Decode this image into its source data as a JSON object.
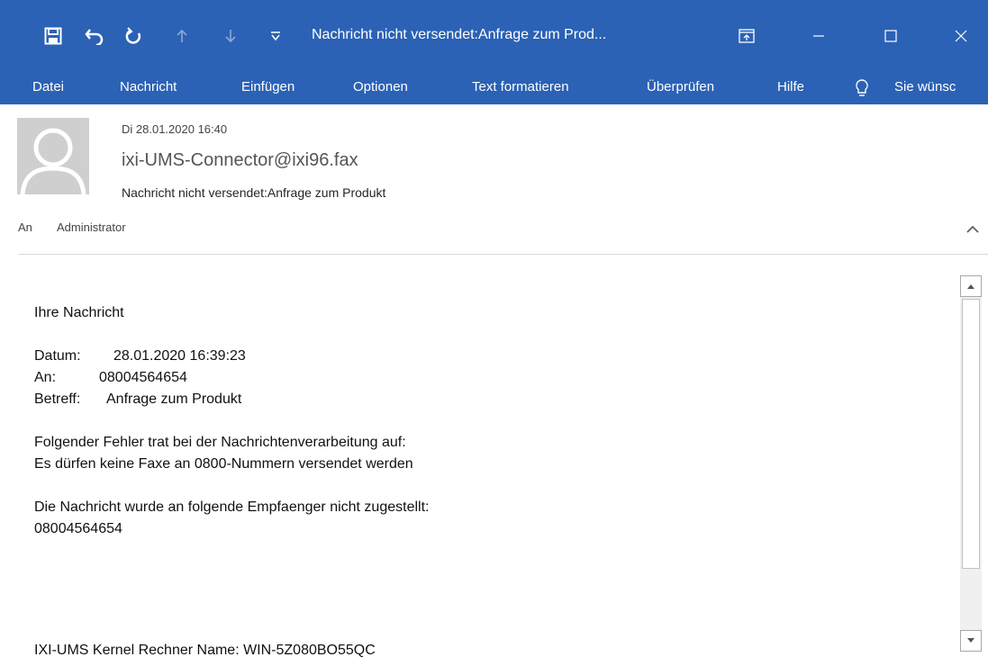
{
  "window": {
    "title": "Nachricht nicht versendet:Anfrage zum Prod...",
    "quick_access": [
      "save-icon",
      "undo-icon",
      "redo-icon",
      "arrow-up-icon",
      "arrow-down-icon",
      "customize-icon"
    ],
    "controls": [
      "ribbon-display-icon",
      "minimize-icon",
      "maximize-icon",
      "close-icon"
    ]
  },
  "ribbon": {
    "tabs": [
      "Datei",
      "Nachricht",
      "Einfügen",
      "Optionen",
      "Text formatieren",
      "Überprüfen",
      "Hilfe"
    ],
    "tell_me": "Sie wünsc"
  },
  "header": {
    "date": "Di 28.01.2020 16:40",
    "from": "ixi-UMS-Connector@ixi96.fax",
    "subject": "Nachricht nicht versendet:Anfrage zum Produkt",
    "to_label": "An",
    "to_value": "Administrator"
  },
  "body": {
    "intro": "Ihre Nachricht",
    "datum_label": "Datum:",
    "datum_value": "28.01.2020 16:39:23",
    "an_label": "An:",
    "an_value": "08004564654",
    "betreff_label": "Betreff:",
    "betreff_value": "Anfrage zum Produkt",
    "error_intro": "Folgender Fehler trat bei der Nachrichtenverarbeitung auf:",
    "error_text": "Es dürfen keine Faxe an 0800-Nummern versendet werden",
    "recipients_intro": "Die Nachricht wurde an folgende Empfaenger nicht zugestellt:",
    "recipient": "08004564654",
    "cut_line": "IXI-UMS Kernel Rechner Name: WIN-5Z080BO55QC"
  },
  "colors": {
    "titlebar": "#2b62b5",
    "avatar": "#cfcfcf"
  }
}
